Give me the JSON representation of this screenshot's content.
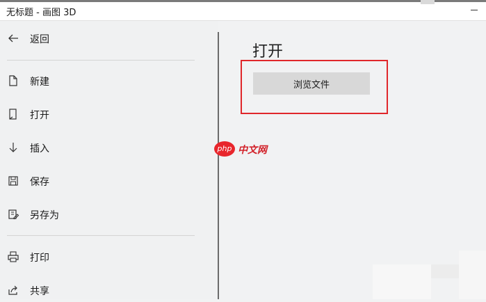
{
  "window": {
    "title": "无标题 - 画图 3D"
  },
  "sidebar": {
    "items": [
      {
        "label": "返回",
        "icon": "arrow-left-icon"
      },
      {
        "label": "新建",
        "icon": "new-file-icon"
      },
      {
        "label": "打开",
        "icon": "open-file-icon"
      },
      {
        "label": "插入",
        "icon": "arrow-down-icon"
      },
      {
        "label": "保存",
        "icon": "save-icon"
      },
      {
        "label": "另存为",
        "icon": "save-as-icon"
      },
      {
        "label": "打印",
        "icon": "printer-icon"
      },
      {
        "label": "共享",
        "icon": "share-icon"
      }
    ]
  },
  "main": {
    "title": "打开",
    "browse_button_label": "浏览文件"
  },
  "watermark": {
    "badge": "php",
    "text": "中文网"
  },
  "colors": {
    "highlight": "#e0262a",
    "watermark": "#e8262c",
    "button": "#d8d8d8",
    "background": "#f1f2f3"
  }
}
